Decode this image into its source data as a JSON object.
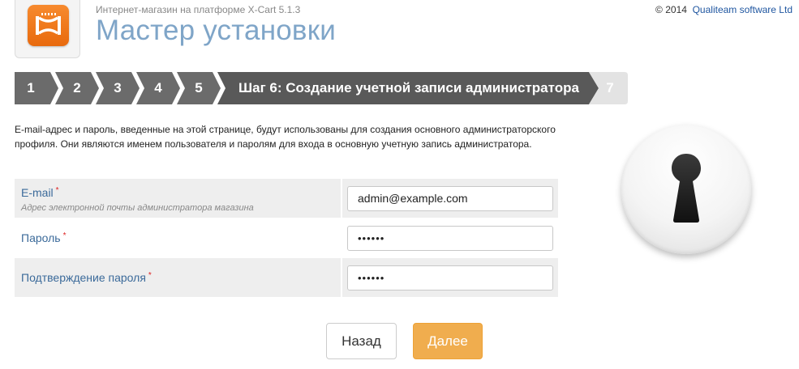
{
  "header": {
    "subtitle": "Интернет-магазин на платформе X-Cart 5.1.3",
    "title": "Мастер установки",
    "copyright_prefix": "© 2014",
    "copyright_link": "Qualiteam software Ltd",
    "logo_icon": "x-cart-logo-icon"
  },
  "steps": {
    "items": [
      {
        "label": "1",
        "state": "done"
      },
      {
        "label": "2",
        "state": "done"
      },
      {
        "label": "3",
        "state": "done"
      },
      {
        "label": "4",
        "state": "done"
      },
      {
        "label": "5",
        "state": "done"
      },
      {
        "label": "Шаг 6: Создание учетной записи администратора",
        "state": "current"
      },
      {
        "label": "7",
        "state": "pending"
      }
    ]
  },
  "intro": "E-mail-адрес и пароль, введенные на этой странице, будут использованы для создания основного администраторского профиля. Они являются именем пользователя и паролям для входа в основную учетную запись администратора.",
  "form": {
    "email_label": "E-mail",
    "email_hint": "Адрес электронной почты администратора магазина",
    "email_value": "admin@example.com",
    "password_label": "Пароль",
    "password_value": "••••••",
    "confirm_label": "Подтверждение пароля",
    "confirm_value": "••••••",
    "required_mark": "*"
  },
  "buttons": {
    "back_label": "Назад",
    "next_label": "Далее"
  },
  "colors": {
    "step_done": "#6b6b6b",
    "step_current": "#595959",
    "step_pending": "#e3e3e3",
    "title_blue": "#7fa5c8",
    "next_button": "#f0ad4e",
    "logo_orange": "#f47b20"
  },
  "icons": {
    "lock": "keyhole-lock-icon"
  }
}
